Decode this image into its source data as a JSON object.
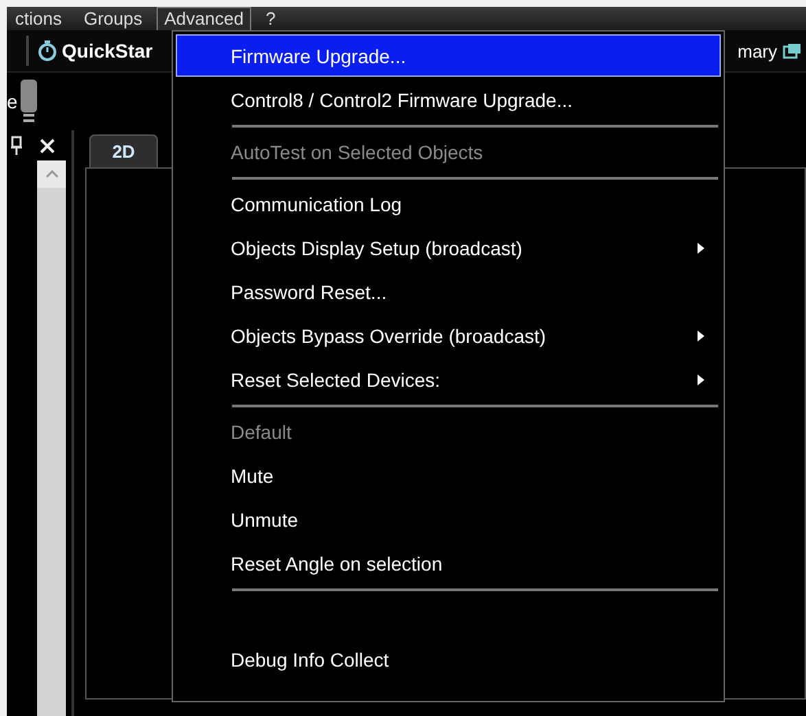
{
  "menu_bar": [
    {
      "label": "ctions",
      "selected": false
    },
    {
      "label": "Groups",
      "selected": false
    },
    {
      "label": "Advanced",
      "selected": true
    },
    {
      "label": "?",
      "selected": false
    }
  ],
  "toolbar": {
    "left_button": "QuickStar",
    "right_button": "mary"
  },
  "side_panel": {
    "label": "e"
  },
  "tabs": [
    {
      "label": "2D",
      "selected": true
    }
  ],
  "dropdown_menu": [
    {
      "kind": "item",
      "label": "Firmware Upgrade...",
      "selected": true,
      "disabled": false,
      "submenu": false
    },
    {
      "kind": "item",
      "label": "Control8 / Control2 Firmware Upgrade...",
      "selected": false,
      "disabled": false,
      "submenu": false
    },
    {
      "kind": "separator"
    },
    {
      "kind": "item",
      "label": "AutoTest on Selected Objects",
      "selected": false,
      "disabled": true,
      "submenu": false
    },
    {
      "kind": "separator"
    },
    {
      "kind": "item",
      "label": "Communication Log",
      "selected": false,
      "disabled": false,
      "submenu": false
    },
    {
      "kind": "item",
      "label": "Objects Display Setup (broadcast)",
      "selected": false,
      "disabled": false,
      "submenu": true
    },
    {
      "kind": "item",
      "label": "Password Reset...",
      "selected": false,
      "disabled": false,
      "submenu": false
    },
    {
      "kind": "item",
      "label": "Objects Bypass Override (broadcast)",
      "selected": false,
      "disabled": false,
      "submenu": true
    },
    {
      "kind": "item",
      "label": "Reset Selected Devices:",
      "selected": false,
      "disabled": false,
      "submenu": true
    },
    {
      "kind": "separator"
    },
    {
      "kind": "item",
      "label": "Default",
      "selected": false,
      "disabled": true,
      "submenu": false
    },
    {
      "kind": "item",
      "label": "Mute",
      "selected": false,
      "disabled": false,
      "submenu": false
    },
    {
      "kind": "item",
      "label": "Unmute",
      "selected": false,
      "disabled": false,
      "submenu": false
    },
    {
      "kind": "item",
      "label": "Reset Angle on selection",
      "selected": false,
      "disabled": false,
      "submenu": false
    },
    {
      "kind": "separator"
    },
    {
      "kind": "blank"
    },
    {
      "kind": "item",
      "label": "Debug Info Collect",
      "selected": false,
      "disabled": false,
      "submenu": false
    }
  ]
}
